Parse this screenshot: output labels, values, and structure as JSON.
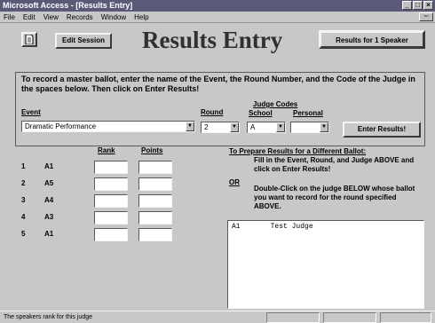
{
  "window": {
    "title": "Microsoft Access - [Results Entry]"
  },
  "menu": [
    "File",
    "Edit",
    "View",
    "Records",
    "Window",
    "Help"
  ],
  "toolbar": {
    "edit_label": "Edit Session",
    "results_label": "Results for 1 Speaker",
    "page_title": "Results Entry"
  },
  "instructions": "To record a master ballot, enter the name of the Event, the Round Number, and the Code of the Judge in the spaces below. Then click on Enter Results!",
  "labels": {
    "event": "Event",
    "round": "Round",
    "judge_codes": "Judge Codes",
    "school": "School",
    "personal": "Personal"
  },
  "fields": {
    "event_value": "Dramatic Performance",
    "round_value": "2",
    "school_value": "A",
    "personal_value": ""
  },
  "enter_button": "Enter Results!",
  "columns": {
    "rank": "Rank",
    "points": "Points"
  },
  "rows": [
    {
      "num": "1",
      "code": "A1"
    },
    {
      "num": "2",
      "code": "A5"
    },
    {
      "num": "3",
      "code": "A4"
    },
    {
      "num": "4",
      "code": "A3"
    },
    {
      "num": "5",
      "code": "A1"
    }
  ],
  "help": {
    "title": "To Prepare Results for a Different Ballot:",
    "body1": "Fill in the Event, Round, and Judge ABOVE and click on Enter Results!",
    "or": "OR",
    "body2": "Double-Click on the judge BELOW whose ballot you want to record for the round specified ABOVE."
  },
  "judges": [
    {
      "code": "A1",
      "name": "Test Judge"
    }
  ],
  "status": {
    "text": "The speakers rank for this judge"
  }
}
